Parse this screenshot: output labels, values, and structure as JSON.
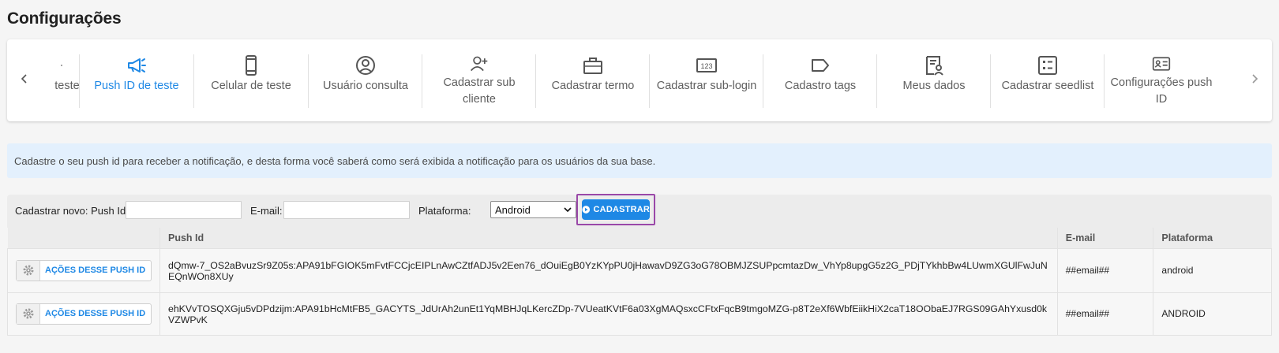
{
  "page": {
    "title": "Configurações"
  },
  "menu": {
    "prev_icon": "chevron-left-icon",
    "next_icon": "chevron-right-icon",
    "items": [
      {
        "label": "teste",
        "icon": "partial-icon",
        "active": false
      },
      {
        "label": "Push ID de teste",
        "icon": "megaphone-icon",
        "active": true
      },
      {
        "label": "Celular de teste",
        "icon": "smartphone-icon",
        "active": false
      },
      {
        "label": "Usuário consulta",
        "icon": "user-circle-icon",
        "active": false
      },
      {
        "label": "Cadastrar sub cliente",
        "icon": "user-add-icon",
        "active": false
      },
      {
        "label": "Cadastrar termo",
        "icon": "briefcase-icon",
        "active": false
      },
      {
        "label": "Cadastrar sub-login",
        "icon": "pin-123-icon",
        "active": false
      },
      {
        "label": "Cadastro tags",
        "icon": "tag-icon",
        "active": false
      },
      {
        "label": "Meus dados",
        "icon": "profile-document-icon",
        "active": false
      },
      {
        "label": "Cadastrar seedlist",
        "icon": "list-box-icon",
        "active": false
      },
      {
        "label": "Configurações push ID",
        "icon": "id-card-icon",
        "active": false
      }
    ]
  },
  "info": {
    "text": "Cadastre o seu push id para receber a notificação, e desta forma você saberá como será exibida a notificação para os usuários da sua base."
  },
  "form": {
    "push_label": "Cadastrar novo: Push Id:",
    "push_value": "",
    "email_label": "E-mail:",
    "email_value": "",
    "platform_label": "Plataforma:",
    "platform_selected": "Android",
    "submit_label": "CADASTRAR"
  },
  "table": {
    "headers": [
      "",
      "Push Id",
      "E-mail",
      "Plataforma"
    ],
    "action_label": "AÇÕES DESSE PUSH ID",
    "rows": [
      {
        "push_id": "dQmw-7_OS2aBvuzSr9Z05s:APA91bFGIOK5mFvtFCCjcEIPLnAwCZtfADJ5v2Een76_dOuiEgB0YzKYpPU0jHawavD9ZG3oG78OBMJZSUPpcmtazDw_VhYp8upgG5z2G_PDjTYkhbBw4LUwmXGUlFwJuNEQnWOn8XUy",
        "email": "##email##",
        "platform": "android"
      },
      {
        "push_id": "ehKVvTOSQXGju5vDPdzijm:APA91bHcMtFB5_GACYTS_JdUrAh2unEt1YqMBHJqLKercZDp-7VUeatKVtF6a03XgMAQsxcCFtxFqcB9tmgoMZG-p8T2eXf6WbfEiikHiX2caT18OObaEJ7RGS09GAhYxusd0kVZWPvK",
        "email": "##email##",
        "platform": "ANDROID"
      }
    ]
  },
  "colors": {
    "accent": "#1e88e5",
    "highlight": "#9a48a8",
    "banner": "#e3f0fd"
  }
}
